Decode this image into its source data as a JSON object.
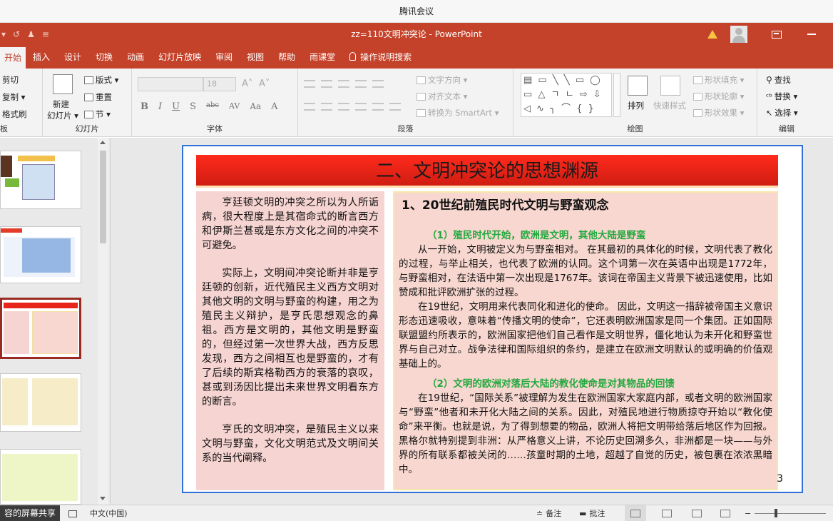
{
  "meeting": {
    "title": "腾讯会议"
  },
  "window": {
    "title": "zz=110文明冲突论  -  PowerPoint",
    "qat": [
      "▾",
      "↺",
      "♟",
      "≡"
    ]
  },
  "tabs": [
    "开始",
    "插入",
    "设计",
    "切换",
    "动画",
    "幻灯片放映",
    "审阅",
    "视图",
    "帮助",
    "雨课堂",
    "操作说明搜索"
  ],
  "ribbon": {
    "clipboard": {
      "cut": "剪切",
      "copy": "复制 ▾",
      "painter": "格式刷",
      "label": "板"
    },
    "slides": {
      "new_slide": "新建",
      "new_slide2": "幻灯片 ▾",
      "layout": "版式 ▾",
      "reset": "重置",
      "section": "节 ▾",
      "label": "幻灯片"
    },
    "font": {
      "size": "18",
      "grow": "A˄",
      "shrink": "A˅",
      "buttons": [
        "B",
        "I",
        "U",
        "S",
        "abc",
        "AV",
        "Aa",
        "A"
      ],
      "label": "字体"
    },
    "paragraph": {
      "text_direction": "文字方向 ▾",
      "align_text": "对齐文本 ▾",
      "smartart": "转换为 SmartArt ▾",
      "label": "段落"
    },
    "drawing": {
      "shapes_row1": "▤ ▭ ╲ ╲ ▭ ◯",
      "shapes_row2": "▭ △ ㄱ ㄴ ⇨ ⇩",
      "shapes_row3": "◁ ∿ ╮ ⌒ { }",
      "arrange": "排列",
      "quick_styles": "快速样式",
      "fill": "形状填充 ▾",
      "outline": "形状轮廓 ▾",
      "effects": "形状效果 ▾",
      "label": "绘图"
    },
    "editing": {
      "find": "查找",
      "replace": "替换 ▾",
      "select": "选择 ▾",
      "label": "编辑"
    }
  },
  "slide": {
    "title": "二、文明冲突论的思想渊源",
    "left_paragraphs": [
      "亨廷顿文明的冲突之所以为人所诟病，很大程度上是其宿命式的断言西方和伊斯兰甚或是东方文化之间的冲突不可避免。",
      "实际上，文明间冲突论断并非是亨廷顿的创新，近代殖民主义西方文明对其他文明的文明与野蛮的构建，用之为殖民主义辩护，是亨氏思想观念的鼻祖。西方是文明的，其他文明是野蛮的，但经过第一次世界大战，西方反思发现，西方之间相互也是野蛮的，才有了后续的斯宾格勒西方的衰落的哀叹，甚或到汤因比提出未来世界文明看东方的断言。",
      "亨氏的文明冲突，是殖民主义以来文明与野蛮，文化文明范式及文明间关系的当代阐释。"
    ],
    "right_heading": "1、20世纪前殖民时代文明与野蛮观念",
    "sub1": "（1）殖民时代开始，欧洲是文明，其他大陆是野蛮",
    "p1": "从一开始，文明被定义为与野蛮相对。 在其最初的具体化的时候，文明代表了教化的过程，与举止相关，也代表了欧洲的认同。这个词第一次在英语中出现是1772年， 与野蛮相对，在法语中第一次出现是1767年。该词在帝国主义背景下被迅速使用，比如赞成和批评欧洲扩张的过程。",
    "p2": "在19世纪，文明用来代表同化和进化的使命。 因此，文明这一措辞被帝国主义意识形态迅速吸收，意味着“传播文明的使命”，它还表明欧洲国家是同一个集团。正如国际联盟盟约所表示的，欧洲国家把他们自己看作是文明世界，僵化地认为未开化和野蛮世界与自己对立。战争法律和国际组织的条约，是建立在欧洲文明默认的或明确的价值观基础上的。",
    "sub2": "（2）文明的欧洲对落后大陆的教化使命是对其物品的回馈",
    "p3": "在19世纪，“国际关系”被理解为发生在欧洲国家大家庭内部，或者文明的欧洲国家与“野蛮”他者和未开化大陆之间的关系。因此，对殖民地进行物质掠夺开始以“教化使命”来平衡。也就是说，为了得到想要的物品，欧洲人将把文明带给落后地区作为回报。黑格尔就特别提到非洲：从严格意义上讲，不论历史回溯多久，非洲都是一块——与外界的所有联系都被关闭的……孩童时期的土地，超越了自觉的历史，被包裹在浓浓黑暗中。",
    "number": "3"
  },
  "statusbar": {
    "share": "容的屏幕共享",
    "language": "中文(中国)",
    "notes": "备注",
    "comments": "批注"
  },
  "colors": {
    "accent": "#c4422a",
    "title_red": "#e8251a",
    "green_sub": "#22a83e",
    "selection_blue": "#2f6fd8"
  }
}
